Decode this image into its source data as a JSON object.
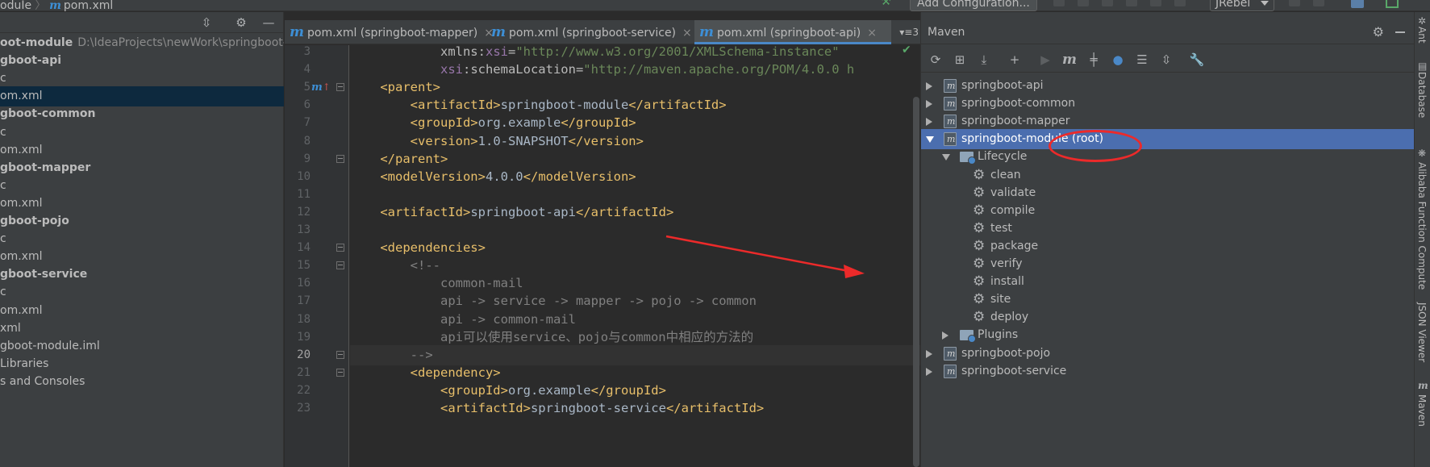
{
  "breadcrumb": {
    "module": "oduIe",
    "file": "pom.xml"
  },
  "toolbar": {
    "add_configuration": "Add Configuration...",
    "jrebel": "JRebel"
  },
  "project": {
    "rows": [
      {
        "text": "oot-module",
        "path": "D:\\IdeaProjects\\newWork\\springboot-m",
        "bold": true,
        "selected": false
      },
      {
        "text": "gboot-api",
        "path": "",
        "bold": true,
        "selected": false
      },
      {
        "text": "c",
        "path": "",
        "bold": false,
        "selected": false
      },
      {
        "text": "om.xml",
        "path": "",
        "bold": false,
        "selected": true
      },
      {
        "text": "gboot-common",
        "path": "",
        "bold": true,
        "selected": false
      },
      {
        "text": "c",
        "path": "",
        "bold": false,
        "selected": false
      },
      {
        "text": "om.xml",
        "path": "",
        "bold": false,
        "selected": false
      },
      {
        "text": "gboot-mapper",
        "path": "",
        "bold": true,
        "selected": false
      },
      {
        "text": "c",
        "path": "",
        "bold": false,
        "selected": false
      },
      {
        "text": "om.xml",
        "path": "",
        "bold": false,
        "selected": false
      },
      {
        "text": "gboot-pojo",
        "path": "",
        "bold": true,
        "selected": false
      },
      {
        "text": "c",
        "path": "",
        "bold": false,
        "selected": false
      },
      {
        "text": "om.xml",
        "path": "",
        "bold": false,
        "selected": false
      },
      {
        "text": "gboot-service",
        "path": "",
        "bold": true,
        "selected": false
      },
      {
        "text": "c",
        "path": "",
        "bold": false,
        "selected": false
      },
      {
        "text": "om.xml",
        "path": "",
        "bold": false,
        "selected": false
      },
      {
        "text": "xml",
        "path": "",
        "bold": false,
        "selected": false
      },
      {
        "text": "gboot-module.iml",
        "path": "",
        "bold": false,
        "selected": false
      },
      {
        "text": "Libraries",
        "path": "",
        "bold": false,
        "selected": false
      },
      {
        "text": "s and Consoles",
        "path": "",
        "bold": false,
        "selected": false
      }
    ]
  },
  "editor": {
    "tabs": [
      {
        "label": "pom.xml (springboot-mapper)",
        "active": false
      },
      {
        "label": "pom.xml (springboot-service)",
        "active": false
      },
      {
        "label": "pom.xml (springboot-api)",
        "active": true
      }
    ],
    "tabs_more": "▾≡3",
    "current_line": 20,
    "lines": [
      {
        "n": 3,
        "parts": [
          [
            "tx",
            "            "
          ],
          [
            "at",
            "xmlns:"
          ],
          [
            "ns",
            "xsi"
          ],
          [
            "at",
            "="
          ],
          [
            "av",
            "\"http://www.w3.org/2001/XMLSchema-instance\""
          ]
        ]
      },
      {
        "n": 4,
        "parts": [
          [
            "tx",
            "            "
          ],
          [
            "ns",
            "xsi"
          ],
          [
            "at",
            ":schemaLocation="
          ],
          [
            "av",
            "\"http://maven.apache.org/POM/4.0.0 h"
          ]
        ]
      },
      {
        "n": 5,
        "parts": [
          [
            "tx",
            "    "
          ],
          [
            "tg",
            "<parent>"
          ]
        ]
      },
      {
        "n": 6,
        "parts": [
          [
            "tx",
            "        "
          ],
          [
            "tg",
            "<artifactId>"
          ],
          [
            "tx",
            "springboot-module"
          ],
          [
            "tg",
            "</artifactId>"
          ]
        ]
      },
      {
        "n": 7,
        "parts": [
          [
            "tx",
            "        "
          ],
          [
            "tg",
            "<groupId>"
          ],
          [
            "tx",
            "org.example"
          ],
          [
            "tg",
            "</groupId>"
          ]
        ]
      },
      {
        "n": 8,
        "parts": [
          [
            "tx",
            "        "
          ],
          [
            "tg",
            "<version>"
          ],
          [
            "tx",
            "1.0-SNAPSHOT"
          ],
          [
            "tg",
            "</version>"
          ]
        ]
      },
      {
        "n": 9,
        "parts": [
          [
            "tx",
            "    "
          ],
          [
            "tg",
            "</parent>"
          ]
        ]
      },
      {
        "n": 10,
        "parts": [
          [
            "tx",
            "    "
          ],
          [
            "tg",
            "<modelVersion>"
          ],
          [
            "tx",
            "4.0.0"
          ],
          [
            "tg",
            "</modelVersion>"
          ]
        ]
      },
      {
        "n": 11,
        "parts": []
      },
      {
        "n": 12,
        "parts": [
          [
            "tx",
            "    "
          ],
          [
            "tg",
            "<artifactId>"
          ],
          [
            "tx",
            "springboot-api"
          ],
          [
            "tg",
            "</artifactId>"
          ]
        ]
      },
      {
        "n": 13,
        "parts": []
      },
      {
        "n": 14,
        "parts": [
          [
            "tx",
            "    "
          ],
          [
            "tg",
            "<dependencies>"
          ]
        ]
      },
      {
        "n": 15,
        "parts": [
          [
            "tx",
            "        "
          ],
          [
            "cm",
            "<!--"
          ]
        ]
      },
      {
        "n": 16,
        "parts": [
          [
            "cm",
            "            common-mail"
          ]
        ]
      },
      {
        "n": 17,
        "parts": [
          [
            "cm",
            "            api -> service -> mapper -> pojo -> common"
          ]
        ]
      },
      {
        "n": 18,
        "parts": [
          [
            "cm",
            "            api -> common-mail"
          ]
        ]
      },
      {
        "n": 19,
        "parts": [
          [
            "cm",
            "            api可以使用service、pojo与common中相应的方法的"
          ]
        ]
      },
      {
        "n": 20,
        "parts": [
          [
            "cm",
            "        -->"
          ]
        ]
      },
      {
        "n": 21,
        "parts": [
          [
            "tx",
            "        "
          ],
          [
            "tg",
            "<dependency>"
          ]
        ]
      },
      {
        "n": 22,
        "parts": [
          [
            "tx",
            "            "
          ],
          [
            "tg",
            "<groupId>"
          ],
          [
            "tx",
            "org.example"
          ],
          [
            "tg",
            "</groupId>"
          ]
        ]
      },
      {
        "n": 23,
        "parts": [
          [
            "tx",
            "            "
          ],
          [
            "tg",
            "<artifactId>"
          ],
          [
            "tx",
            "springboot-service"
          ],
          [
            "tg",
            "</artifactId>"
          ]
        ]
      }
    ]
  },
  "maven": {
    "title": "Maven",
    "rows": [
      {
        "label": "springboot-api",
        "kind": "module",
        "level": 0,
        "expander": "right"
      },
      {
        "label": "springboot-common",
        "kind": "module",
        "level": 0,
        "expander": "right"
      },
      {
        "label": "springboot-mapper",
        "kind": "module",
        "level": 0,
        "expander": "right"
      },
      {
        "label": "springboot-module (root)",
        "kind": "module",
        "level": 0,
        "expander": "down",
        "selected": true
      },
      {
        "label": "Lifecycle",
        "kind": "folder",
        "level": 1,
        "expander": "down"
      },
      {
        "label": "clean",
        "kind": "goal",
        "level": 2
      },
      {
        "label": "validate",
        "kind": "goal",
        "level": 2
      },
      {
        "label": "compile",
        "kind": "goal",
        "level": 2
      },
      {
        "label": "test",
        "kind": "goal",
        "level": 2
      },
      {
        "label": "package",
        "kind": "goal",
        "level": 2
      },
      {
        "label": "verify",
        "kind": "goal",
        "level": 2
      },
      {
        "label": "install",
        "kind": "goal",
        "level": 2
      },
      {
        "label": "site",
        "kind": "goal",
        "level": 2
      },
      {
        "label": "deploy",
        "kind": "goal",
        "level": 2
      },
      {
        "label": "Plugins",
        "kind": "folder",
        "level": 1,
        "expander": "right"
      },
      {
        "label": "springboot-pojo",
        "kind": "module",
        "level": 0,
        "expander": "right"
      },
      {
        "label": "springboot-service",
        "kind": "module",
        "level": 0,
        "expander": "right"
      }
    ]
  },
  "right_strip": {
    "labels": [
      "Ant",
      "Database",
      "Alibaba Function Compute",
      "JSON Viewer",
      "Maven"
    ]
  },
  "colors": {
    "selection": "#4b6eaf",
    "annotation": "#ec2a2a",
    "tag": "#e8bf6a",
    "comment": "#808080"
  }
}
